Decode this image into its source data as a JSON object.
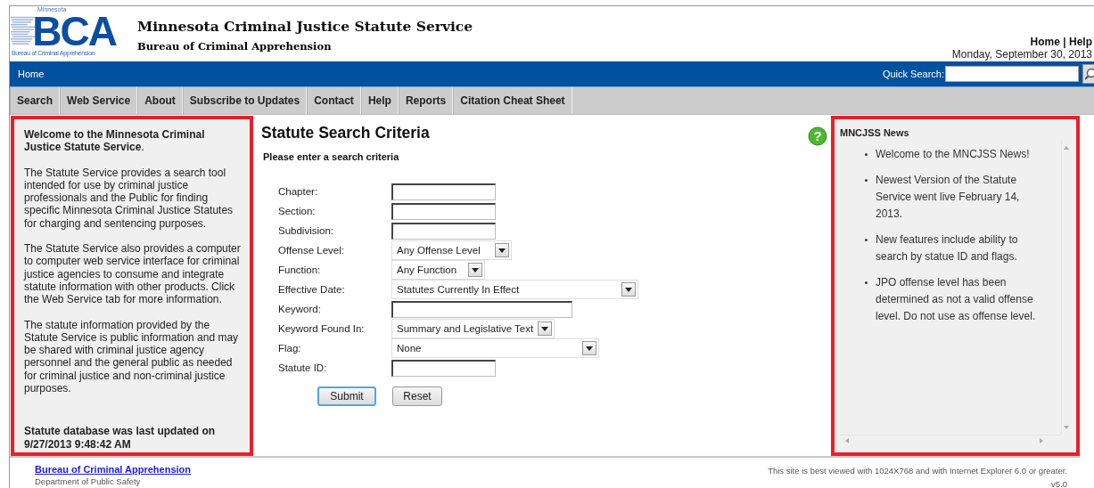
{
  "header": {
    "logo_top": "Minnesota",
    "logo_text": "BCA",
    "logo_bottom": "Bureau of Criminal Apprehension",
    "title": "Minnesota Criminal Justice Statute Service",
    "subtitle": "Bureau of Criminal Apprehension",
    "top_links": [
      "Home",
      "Help"
    ],
    "link_separator": "|",
    "date": "Monday, September 30, 2013"
  },
  "blue_bar": {
    "link": "Home",
    "quick_search_label": "Quick Search:"
  },
  "tabs": [
    {
      "label": "Search"
    },
    {
      "label": "Web Service"
    },
    {
      "label": "About"
    },
    {
      "label": "Subscribe to Updates"
    },
    {
      "label": "Contact"
    },
    {
      "label": "Help"
    },
    {
      "label": "Reports"
    },
    {
      "label": "Citation Cheat Sheet"
    }
  ],
  "welcome": {
    "heading": "**Welcome to the Minnesota Criminal Justice Statute Service**.",
    "paragraphs": [
      "The Statute Service provides a search tool intended for use by criminal justice professionals and the Public for finding specific Minnesota Criminal Justice Statutes for charging and sentencing purposes.",
      "The Statute Service also provides a computer to computer web service interface for criminal justice agencies to consume and integrate statute information with other products. Click the Web Service tab for more information.",
      "The statute information provided by the Statute Service is public information and may be shared with criminal justice agency personnel and the general public as needed for criminal justice and non-criminal justice purposes."
    ],
    "updated": "Statute database was last updated on 9/27/2013 9:48:42 AM"
  },
  "search": {
    "title": "Statute Search Criteria",
    "subtitle": "Please enter a search criteria",
    "help_mark": "?",
    "fields": [
      {
        "kind": "text",
        "label": "Chapter:"
      },
      {
        "kind": "text",
        "label": "Section:"
      },
      {
        "kind": "text",
        "label": "Subdivision:"
      },
      {
        "kind": "select",
        "label": "Offense Level:",
        "value": "Any Offense Level"
      },
      {
        "kind": "select",
        "label": "Function:",
        "value": "Any Function"
      },
      {
        "kind": "select",
        "label": "Effective Date:",
        "value": "Statutes Currently In Effect"
      },
      {
        "kind": "wide-text",
        "label": "Keyword:"
      },
      {
        "kind": "select",
        "label": "Keyword Found In:",
        "value": "Summary and Legislative Text"
      },
      {
        "kind": "select",
        "label": "Flag:",
        "value": "None"
      },
      {
        "kind": "text",
        "label": "Statute ID:"
      }
    ],
    "buttons": [
      {
        "label": "Submit",
        "default": true
      },
      {
        "label": "Reset",
        "default": false
      }
    ]
  },
  "news": {
    "title": "MNCJSS News",
    "items": [
      "Welcome to the MNCJSS News!",
      "Newest Version of the Statute Service went live February 14, 2013.",
      "New features include ability to search by statue ID and flags.",
      "JPO offense level has been determined as not a valid offense level. Do not use as offense level."
    ]
  },
  "footer": {
    "link": "Bureau of Criminal Apprehension",
    "department": "Department of Public Safety",
    "note": "This site is best viewed with 1024X768 and with Internet Explorer 6.0 or greater.",
    "version": "v5.0"
  }
}
